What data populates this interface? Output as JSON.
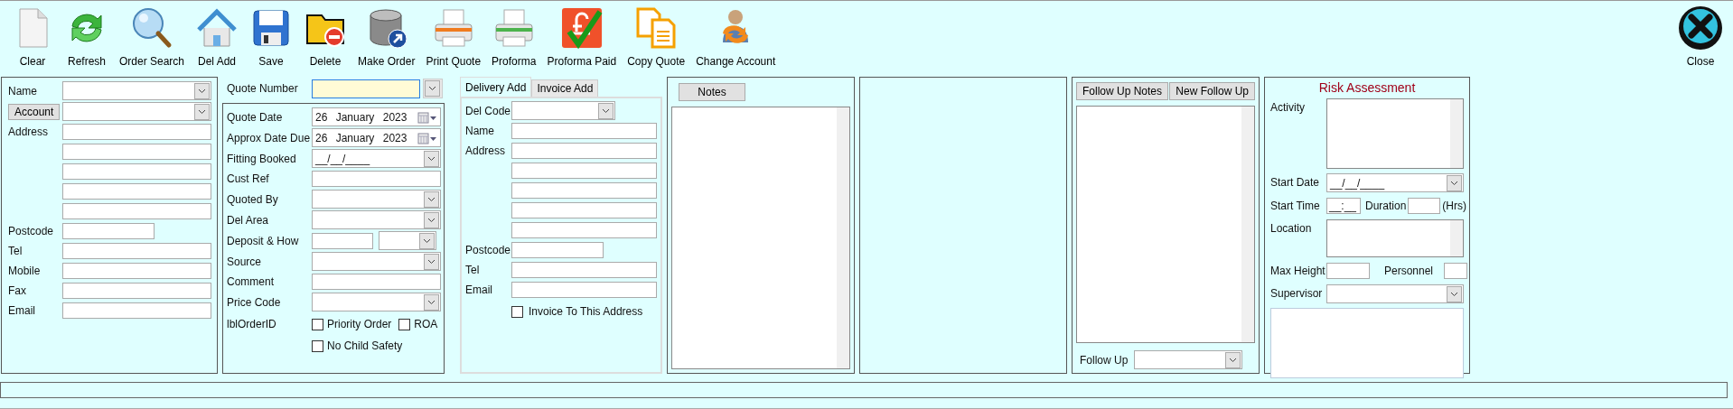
{
  "toolbar": {
    "buttons": [
      {
        "label": "Clear"
      },
      {
        "label": "Refresh"
      },
      {
        "label": "Order Search"
      },
      {
        "label": "Del Add"
      },
      {
        "label": "Save"
      },
      {
        "label": "Delete"
      },
      {
        "label": "Make Order"
      },
      {
        "label": "Print Quote"
      },
      {
        "label": "Proforma"
      },
      {
        "label": "Proforma Paid"
      },
      {
        "label": "Copy Quote"
      },
      {
        "label": "Change Account"
      }
    ],
    "close": {
      "label": "Close"
    }
  },
  "customer": {
    "rows": [
      {
        "kind": "combo",
        "label": "Name"
      },
      {
        "kind": "combo-button",
        "label": "Account"
      },
      {
        "kind": "text",
        "label": "Address"
      },
      {
        "kind": "text"
      },
      {
        "kind": "text"
      },
      {
        "kind": "text"
      },
      {
        "kind": "text"
      },
      {
        "kind": "short",
        "label": "Postcode"
      },
      {
        "kind": "text",
        "label": "Tel"
      },
      {
        "kind": "text",
        "label": "Mobile"
      },
      {
        "kind": "text",
        "label": "Fax"
      },
      {
        "kind": "text",
        "label": "Email"
      }
    ]
  },
  "quote": {
    "number": {
      "label": "Quote Number",
      "focused": true
    },
    "rows": [
      {
        "kind": "date",
        "label": "Quote Date",
        "value": "26 January 2023"
      },
      {
        "kind": "date",
        "label": "Approx Date Due",
        "value": "26 January 2023"
      },
      {
        "kind": "masked",
        "label": "Fitting Booked",
        "value": "__/__/____"
      },
      {
        "kind": "text",
        "label": "Cust Ref"
      },
      {
        "kind": "combo",
        "label": "Quoted By"
      },
      {
        "kind": "combo",
        "label": "Del Area"
      },
      {
        "kind": "text-combo",
        "label": "Deposit & How"
      },
      {
        "kind": "combo",
        "label": "Source"
      },
      {
        "kind": "text",
        "label": "Comment"
      },
      {
        "kind": "combo",
        "label": "Price Code"
      },
      {
        "kind": "checks",
        "label": "lblOrderID",
        "checks": [
          {
            "label": "Priority Order",
            "checked": false
          },
          {
            "label": "ROA",
            "checked": false
          }
        ]
      },
      {
        "kind": "checks",
        "checks": [
          {
            "label": "No Child Safety",
            "checked": false
          }
        ]
      }
    ]
  },
  "address": {
    "tabs": [
      {
        "label": "Delivery Add",
        "selected": true
      },
      {
        "label": "Invoice Add",
        "selected": false
      }
    ],
    "rows": [
      {
        "kind": "combo-small",
        "label": "Del Code"
      },
      {
        "kind": "text",
        "label": "Name"
      },
      {
        "kind": "text",
        "label": "Address"
      },
      {
        "kind": "text"
      },
      {
        "kind": "text"
      },
      {
        "kind": "text"
      },
      {
        "kind": "text"
      },
      {
        "kind": "short",
        "label": "Postcode"
      },
      {
        "kind": "text",
        "label": "Tel"
      },
      {
        "kind": "text",
        "label": "Email"
      },
      {
        "kind": "checks",
        "checks": [
          {
            "label": "Invoice To This Address",
            "checked": false
          }
        ]
      }
    ]
  },
  "notes": {
    "button": "Notes"
  },
  "follow_up": {
    "buttons": [
      "Follow Up Notes",
      "New Follow Up"
    ],
    "field": {
      "label": "Follow Up"
    }
  },
  "risk": {
    "title": "Risk Assessment",
    "rows": [
      {
        "kind": "memo",
        "label": "Activity"
      },
      {
        "kind": "masked",
        "label": "Start Date",
        "value": "__/__/____"
      },
      {
        "kind": "time",
        "label": "Start Time",
        "value": "__:__",
        "label_2": "Duration",
        "suffix": "(Hrs)"
      },
      {
        "kind": "memo",
        "label": "Location"
      },
      {
        "kind": "pair",
        "label": "Max Height",
        "label_2": "Personnel"
      },
      {
        "kind": "combo",
        "label": "Supervisor"
      },
      {
        "kind": "box"
      }
    ]
  }
}
